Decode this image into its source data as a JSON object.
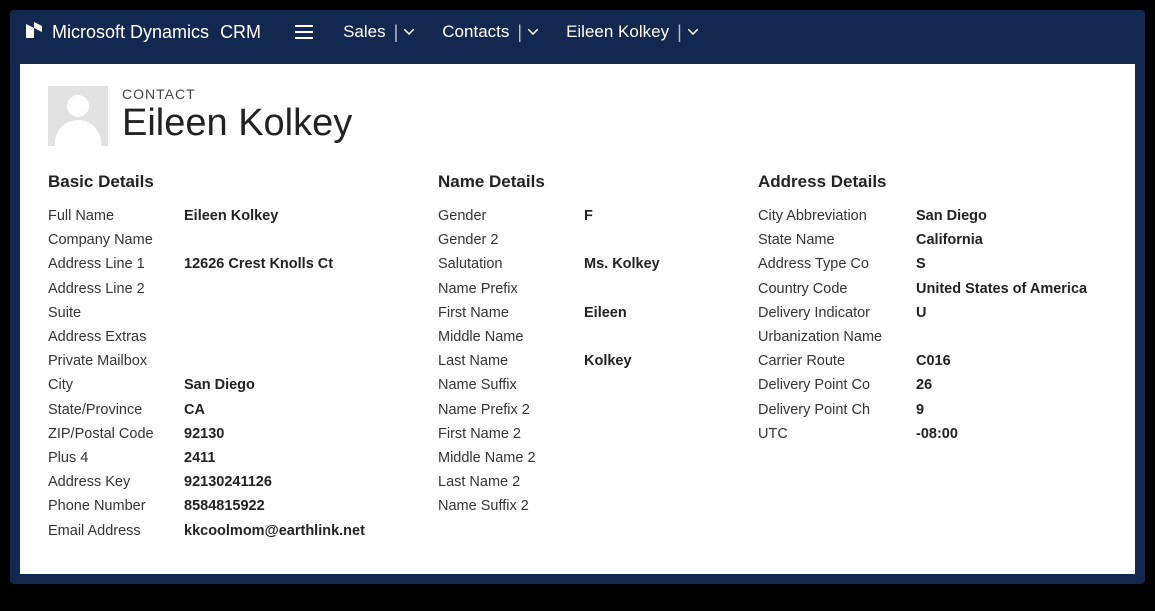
{
  "brand": {
    "t1": "Microsoft",
    "t2": "Dynamics",
    "t3": "CRM"
  },
  "nav": {
    "item1": "Sales",
    "item2": "Contacts",
    "item3": "Eileen Kolkey"
  },
  "header": {
    "entity_label": "CONTACT",
    "entity_name": "Eileen Kolkey"
  },
  "sections": {
    "basic_title": "Basic Details",
    "name_title": "Name Details",
    "address_title": "Address Details"
  },
  "basic": [
    {
      "label": "Full Name",
      "value": "Eileen Kolkey"
    },
    {
      "label": "Company Name",
      "value": ""
    },
    {
      "label": "Address Line 1",
      "value": "12626 Crest Knolls Ct"
    },
    {
      "label": "Address Line 2",
      "value": ""
    },
    {
      "label": "Suite",
      "value": ""
    },
    {
      "label": "Address Extras",
      "value": ""
    },
    {
      "label": "Private Mailbox",
      "value": ""
    },
    {
      "label": "City",
      "value": "San Diego"
    },
    {
      "label": "State/Province",
      "value": "CA"
    },
    {
      "label": "ZIP/Postal Code",
      "value": "92130"
    },
    {
      "label": "Plus 4",
      "value": "2411"
    },
    {
      "label": "Address Key",
      "value": "92130241126"
    },
    {
      "label": "Phone Number",
      "value": "8584815922"
    },
    {
      "label": "Email Address",
      "value": "kkcoolmom@earthlink.net"
    }
  ],
  "name": [
    {
      "label": "Gender",
      "value": "F"
    },
    {
      "label": "Gender 2",
      "value": ""
    },
    {
      "label": "Salutation",
      "value": "Ms. Kolkey"
    },
    {
      "label": "Name Prefix",
      "value": ""
    },
    {
      "label": "First Name",
      "value": "Eileen"
    },
    {
      "label": "Middle Name",
      "value": ""
    },
    {
      "label": "Last Name",
      "value": "Kolkey"
    },
    {
      "label": "Name Suffix",
      "value": ""
    },
    {
      "label": "Name Prefix 2",
      "value": ""
    },
    {
      "label": "First Name 2",
      "value": ""
    },
    {
      "label": "Middle Name 2",
      "value": ""
    },
    {
      "label": "Last Name 2",
      "value": ""
    },
    {
      "label": "Name Suffix 2",
      "value": ""
    }
  ],
  "address": [
    {
      "label": "City Abbreviation",
      "value": "San Diego"
    },
    {
      "label": "State Name",
      "value": "California"
    },
    {
      "label": "Address Type Co",
      "value": "S"
    },
    {
      "label": "Country Code",
      "value": "United States of America"
    },
    {
      "label": "Delivery Indicator",
      "value": "U"
    },
    {
      "label": "Urbanization Name",
      "value": ""
    },
    {
      "label": "Carrier Route",
      "value": "C016"
    },
    {
      "label": "Delivery Point Co",
      "value": "26"
    },
    {
      "label": "Delivery Point Ch",
      "value": "9"
    },
    {
      "label": "UTC",
      "value": "-08:00"
    }
  ]
}
